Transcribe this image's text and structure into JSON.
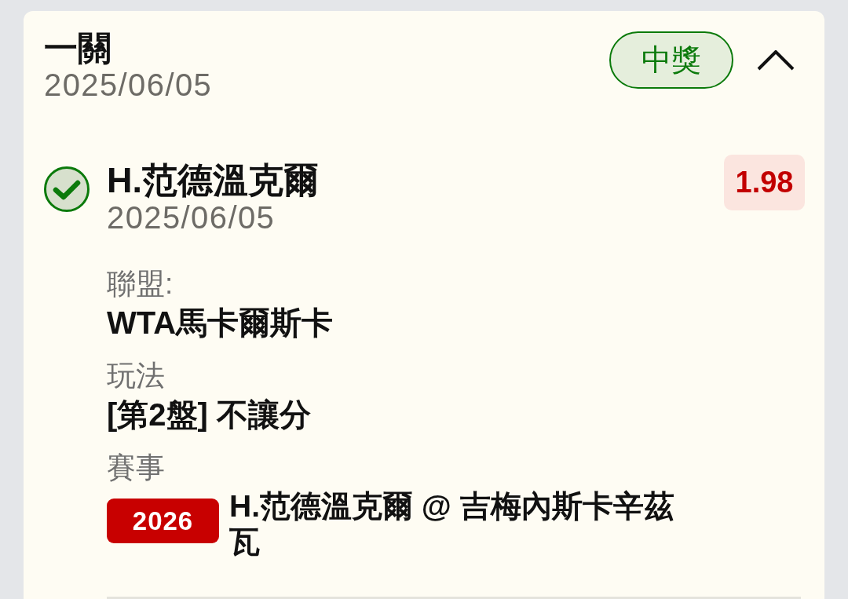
{
  "bet": {
    "title": "一關",
    "date": "2025/06/05",
    "won": true,
    "status_label": "中獎",
    "expanded": true
  },
  "legs": [
    {
      "selection": "H.范德溫克爾",
      "date": "2025/06/05",
      "won": true,
      "odds": "1.98",
      "fields": [
        {
          "kind": "text",
          "label": "聯盟:",
          "value": "WTA馬卡爾斯卡"
        },
        {
          "kind": "text",
          "label": "玩法",
          "value": "[第2盤] 不讓分"
        },
        {
          "kind": "match",
          "label": "賽事",
          "tag": "2026",
          "value": "H.范德溫克爾 @ 吉梅內斯卡辛茲瓦"
        }
      ]
    }
  ]
}
